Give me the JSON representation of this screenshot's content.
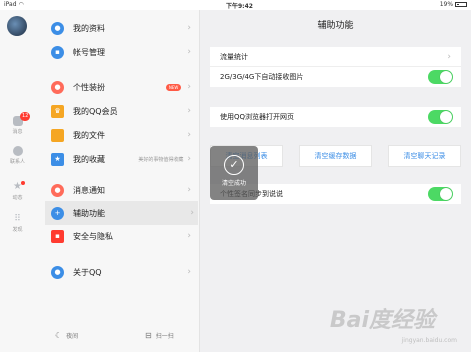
{
  "status_bar": {
    "device": "iPad",
    "wifi": "◠",
    "time": "下午9:42",
    "battery_text": "19%"
  },
  "rail": {
    "items": [
      {
        "label": "消息",
        "badge": "12"
      },
      {
        "label": "联系人"
      },
      {
        "label": "动态"
      },
      {
        "label": "发现"
      }
    ]
  },
  "menu": {
    "items": [
      {
        "label": "我的资料",
        "icon": "profile-icon",
        "color": "#3c8ee6"
      },
      {
        "label": "帐号管理",
        "icon": "account-icon",
        "color": "#3c8ee6"
      },
      {
        "label": "个性装扮",
        "icon": "palette-icon",
        "color": "#ff6b5a",
        "tag": "NEW"
      },
      {
        "label": "我的QQ会员",
        "icon": "crown-icon",
        "color": "#f5a623"
      },
      {
        "label": "我的文件",
        "icon": "folder-icon",
        "color": "#f5a623"
      },
      {
        "label": "我的收藏",
        "icon": "star-icon",
        "color": "#3c8ee6",
        "sub": "美好的事物值得收藏"
      },
      {
        "label": "消息通知",
        "icon": "bell-icon",
        "color": "#ff6b5a"
      },
      {
        "label": "辅助功能",
        "icon": "plus-icon",
        "color": "#3c8ee6"
      },
      {
        "label": "安全与隐私",
        "icon": "lock-icon",
        "color": "#ff3b30"
      },
      {
        "label": "关于QQ",
        "icon": "qq-icon",
        "color": "#3c8ee6"
      }
    ],
    "bottom_left": "夜间",
    "bottom_right": "扫一扫"
  },
  "content": {
    "title": "辅助功能",
    "rows": {
      "traffic": "流量统计",
      "auto_image": "2G/3G/4G下自动接收图片",
      "browser": "使用QQ浏览器打开网页",
      "signature": "个性签名同步到说说"
    },
    "buttons": [
      "清空消息列表",
      "清空缓存数据",
      "清空聊天记录"
    ],
    "toggles": {
      "auto_image": true,
      "browser": true,
      "signature": true
    }
  },
  "toast": {
    "text": "清空成功"
  },
  "watermark": {
    "main": "Bai度经验",
    "sub": "jingyan.baidu.com"
  },
  "colors": {
    "accent": "#3c8ee6",
    "toggle_on": "#4cd964"
  }
}
